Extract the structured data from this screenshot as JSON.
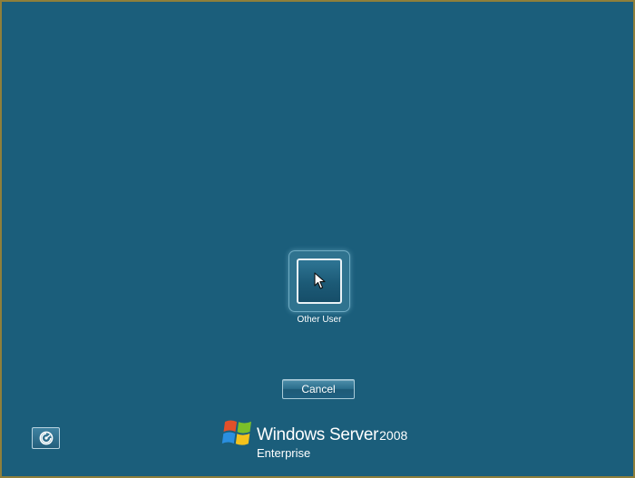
{
  "login": {
    "user_tile_label": "Other User",
    "user_tile_icon": "cursor-arrow-icon",
    "cancel_label": "Cancel",
    "ease_of_access_icon": "ease-of-access-icon"
  },
  "branding": {
    "product_name": "Windows Server",
    "version": "2008",
    "edition": "Enterprise",
    "logo_icon": "windows-flag-icon"
  },
  "colors": {
    "background": "#1b5e7b",
    "border": "#8f7f3a",
    "text": "#ffffff",
    "flag_red": "#e2502a",
    "flag_green": "#7bbf2a",
    "flag_blue": "#2a8fe0",
    "flag_yellow": "#f4c21c"
  }
}
